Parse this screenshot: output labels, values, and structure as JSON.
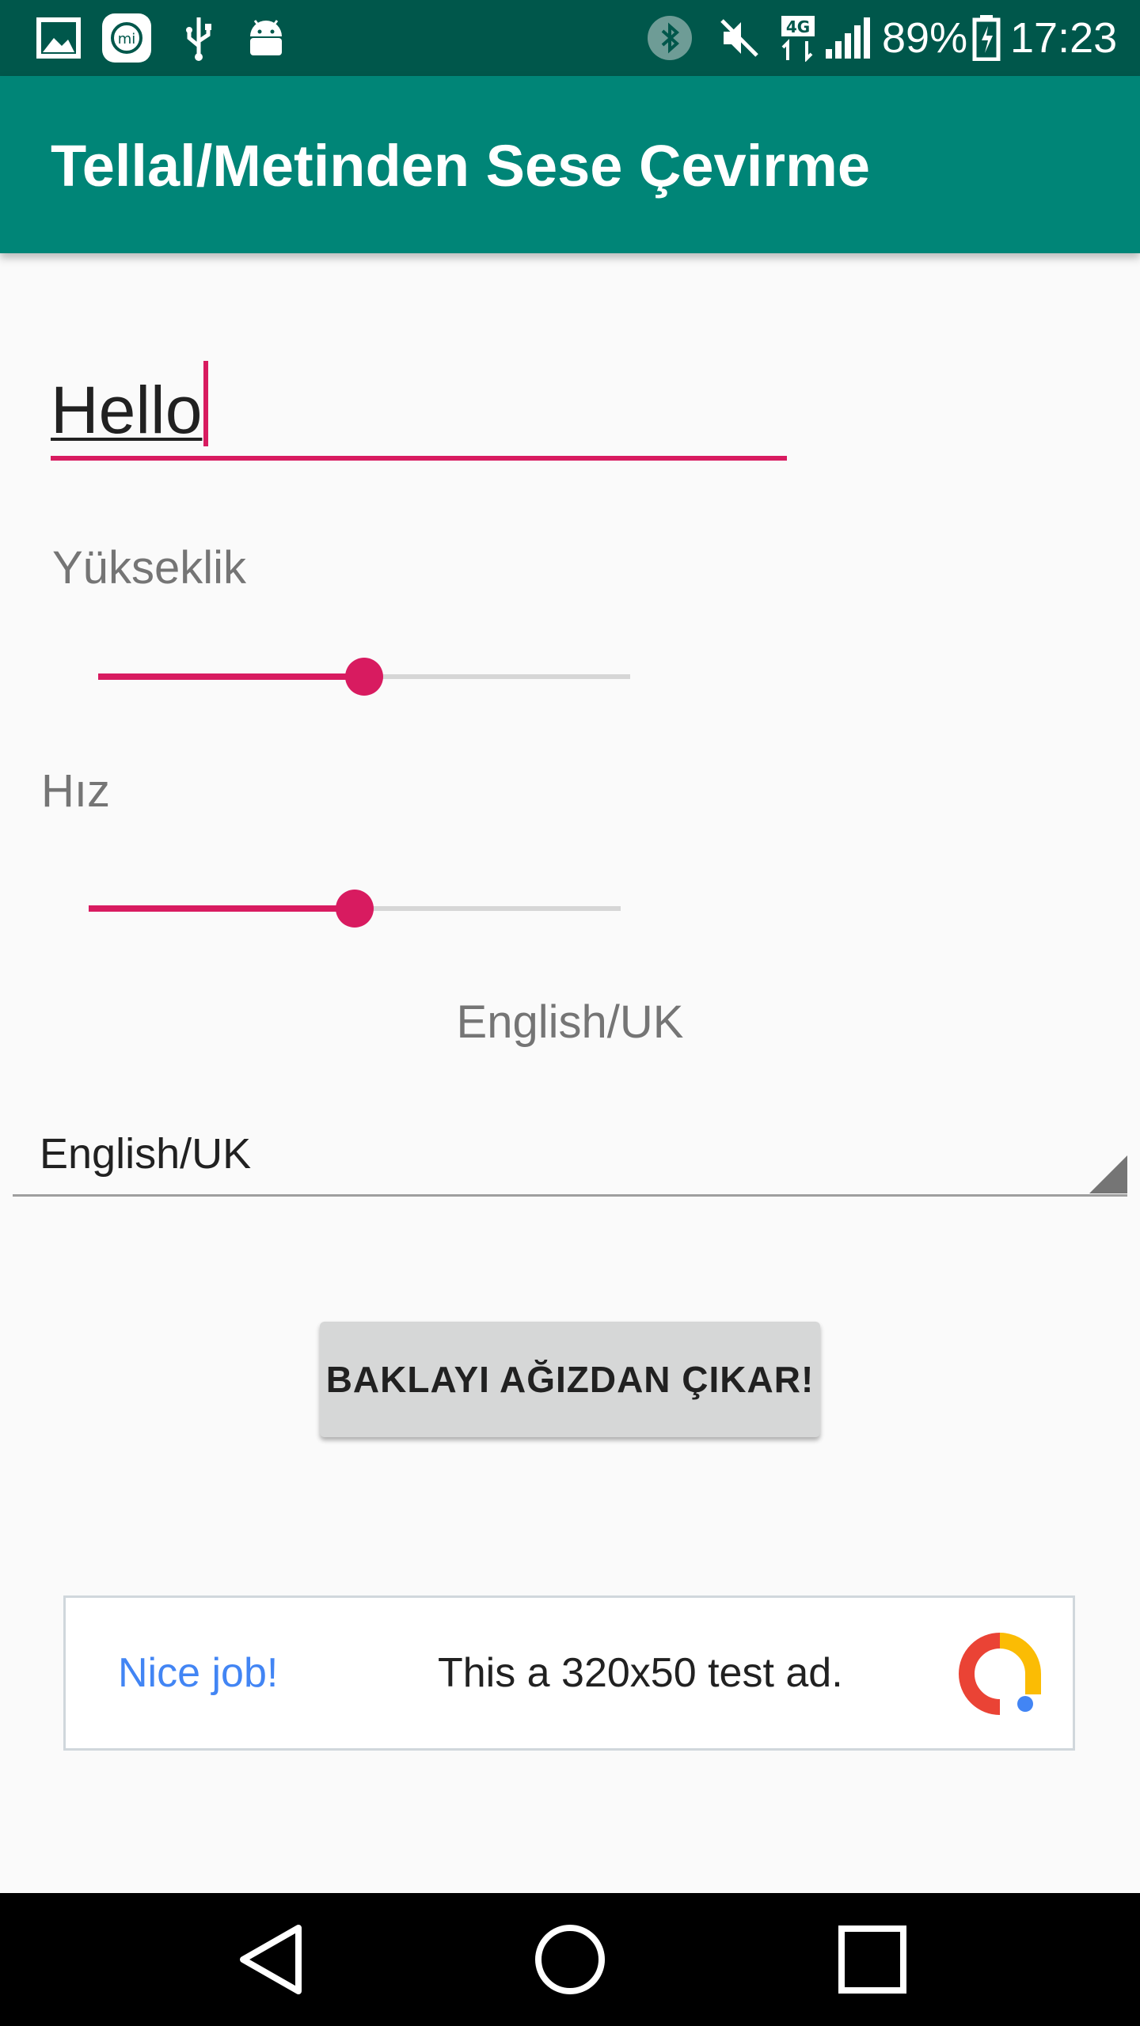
{
  "status_bar": {
    "icons": [
      "gallery-icon",
      "mi-icon",
      "usb-icon",
      "android-debug-icon",
      "bluetooth-icon",
      "mute-icon",
      "4g-icon",
      "signal-icon",
      "battery-charging-icon"
    ],
    "network_label": "4G",
    "battery_percent": "89%",
    "time": "17:23"
  },
  "app_bar": {
    "title": "Tellal/Metinden Sese Çevirme"
  },
  "text_input": {
    "value": "Hello"
  },
  "pitch": {
    "label": "Yükseklik",
    "value_fraction": 0.5
  },
  "speed": {
    "label": "Hız",
    "value_fraction": 0.5
  },
  "language": {
    "selected_label": "English/UK",
    "spinner_value": "English/UK"
  },
  "speak_button": {
    "label": "BAKLAYI AĞIZDAN ÇIKAR!"
  },
  "ad": {
    "left_text": "Nice job!",
    "center_text": "This a 320x50 test ad.",
    "logo_icon": "admob-logo-icon"
  },
  "nav_bar": {
    "icons": [
      "back-icon",
      "home-icon",
      "recents-icon"
    ]
  },
  "colors": {
    "status_bar": "#00574b",
    "app_bar": "#008577",
    "accent": "#d81b60",
    "background": "#fafafa"
  }
}
